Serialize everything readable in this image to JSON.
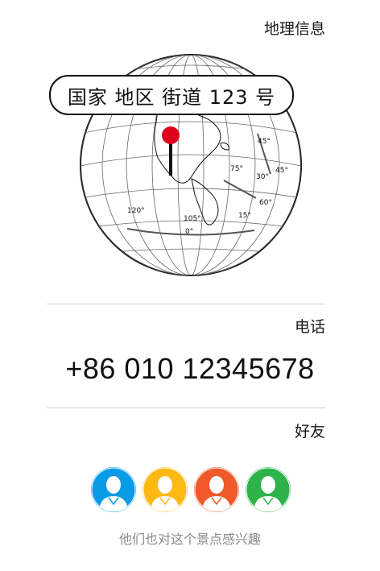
{
  "geo": {
    "section_label": "地理信息",
    "address": "国家 地区 街道 123 号",
    "globe_labels": [
      "45°",
      "75°",
      "30°",
      "45°",
      "60°",
      "15°",
      "120°",
      "105°",
      "0°"
    ],
    "pin_color": "#e0001b"
  },
  "phone": {
    "section_label": "电话",
    "number": "+86 010 12345678"
  },
  "friends": {
    "section_label": "好友",
    "avatars": [
      {
        "icon": "person-icon",
        "color": "#0a9be6"
      },
      {
        "icon": "person-icon",
        "color": "#fdb913"
      },
      {
        "icon": "person-icon",
        "color": "#f05a2b"
      },
      {
        "icon": "person-icon",
        "color": "#2eb34a"
      }
    ],
    "note": "他们也对这个景点感兴趣"
  }
}
